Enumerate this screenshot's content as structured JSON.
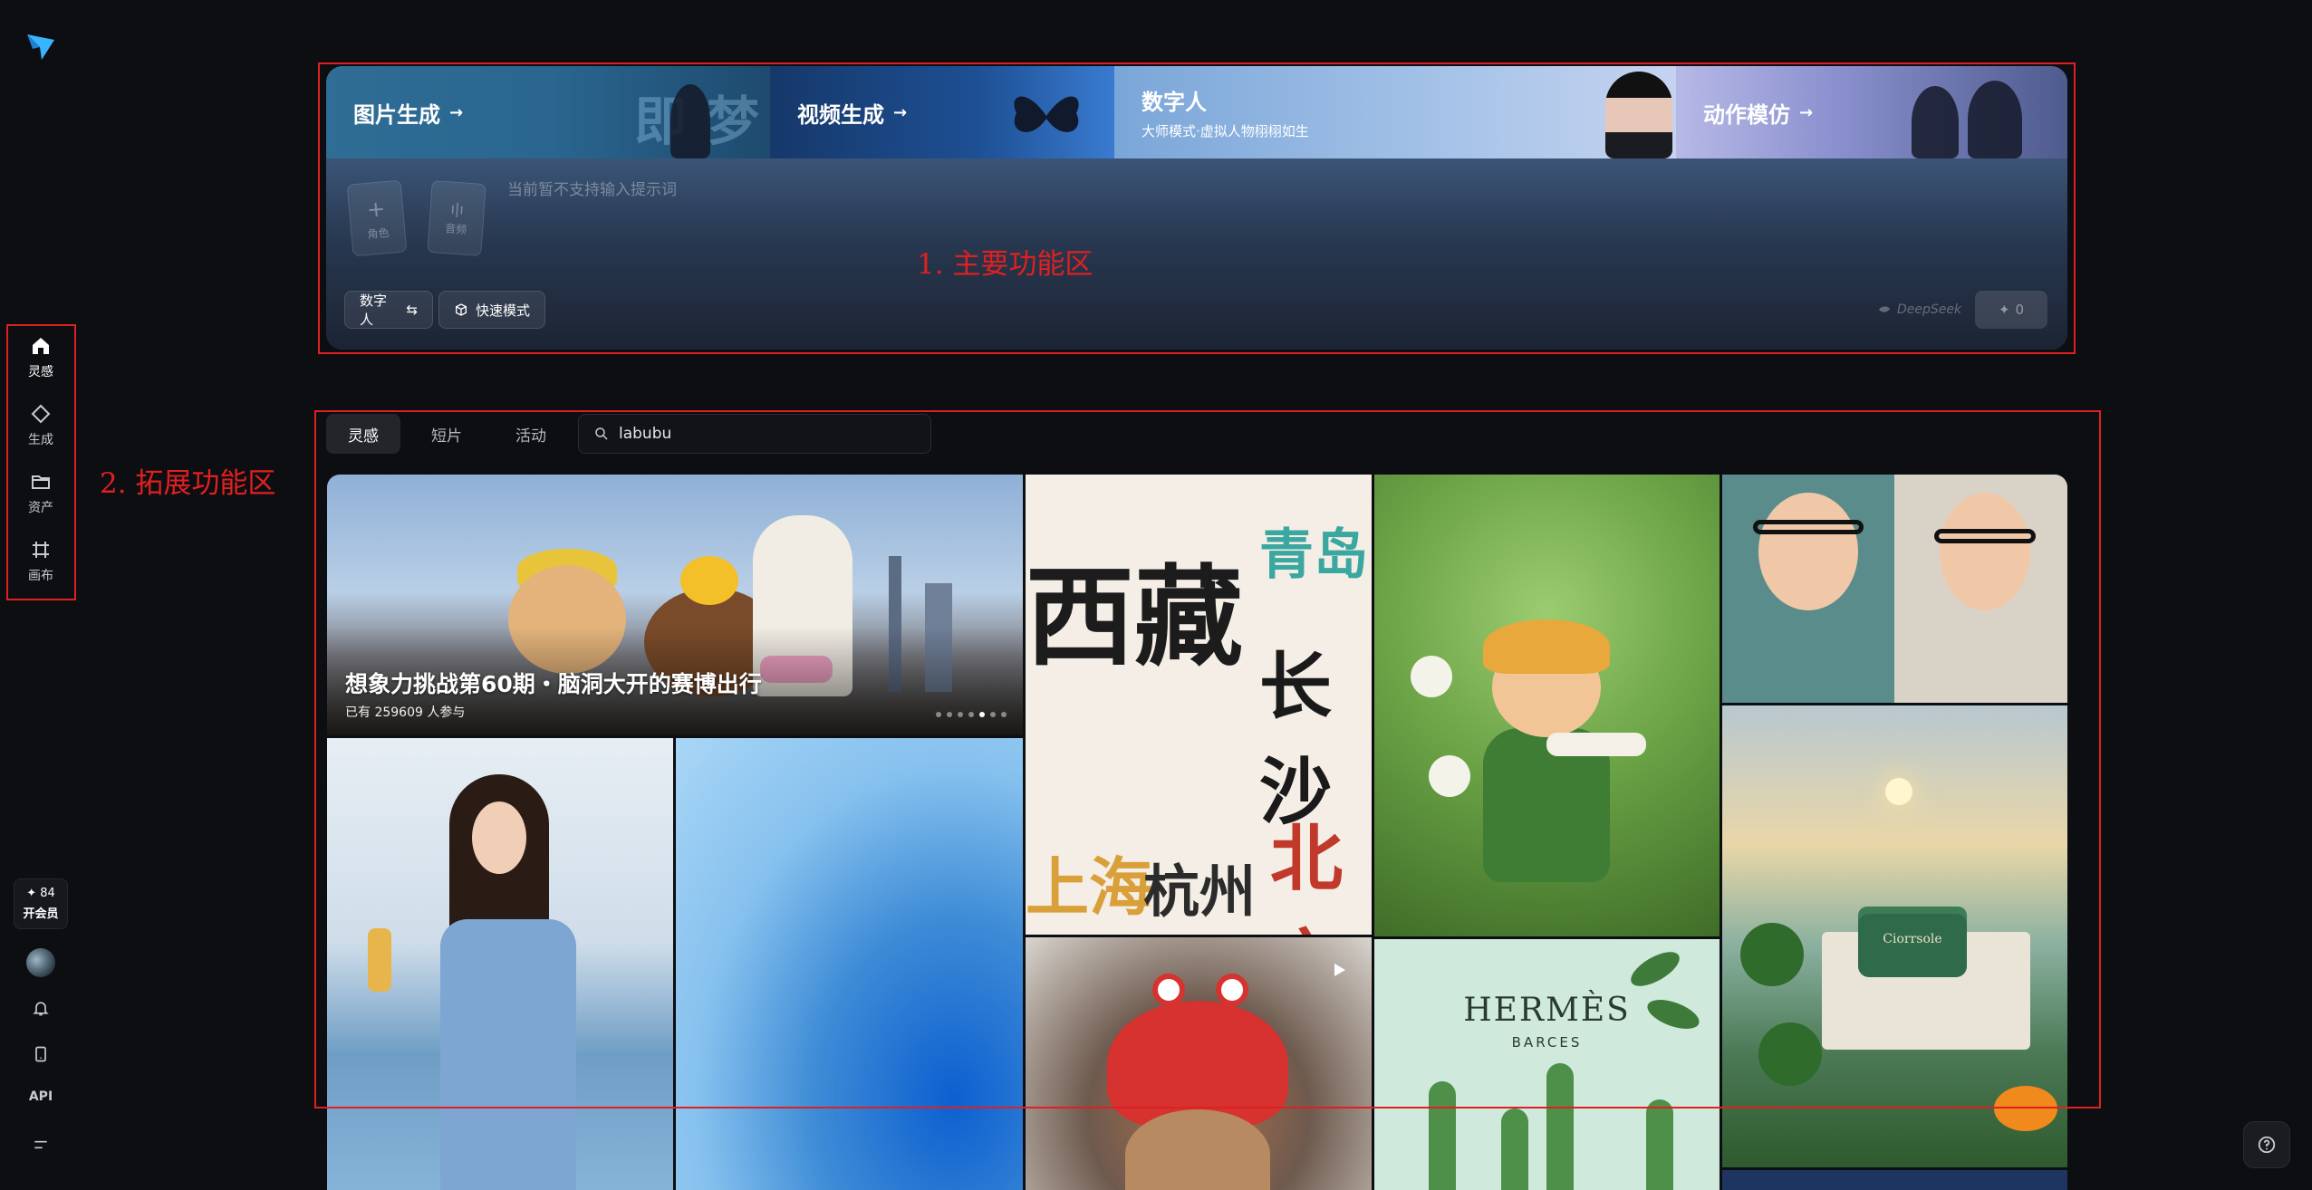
{
  "sidebar": {
    "nav": [
      {
        "label": "灵感",
        "icon": "home-icon"
      },
      {
        "label": "生成",
        "icon": "diamond-icon"
      },
      {
        "label": "资产",
        "icon": "folder-icon"
      },
      {
        "label": "画布",
        "icon": "canvas-icon"
      }
    ],
    "credits": {
      "amount": "✦ 84",
      "vip_label": "开会员"
    },
    "api_label": "API"
  },
  "banner": {
    "image_gen": {
      "label": "图片生成",
      "arrow": "→"
    },
    "video_gen": {
      "label": "视频生成",
      "arrow": "→"
    },
    "digital_human": {
      "label": "数字人",
      "subtitle": "大师模式·虚拟人物栩栩如生"
    },
    "motion_mimic": {
      "label": "动作模仿",
      "arrow": "→"
    },
    "decor_text_1": "即",
    "decor_text_2": "梦"
  },
  "prompt": {
    "role_card": {
      "symbol": "+",
      "label": "角色"
    },
    "voice_card": {
      "symbol": "ı|ı",
      "label": "音频"
    },
    "placeholder": "当前暂不支持输入提示词",
    "mode_pill": "数字人",
    "mode_pill_icon": "⇆",
    "fast_pill": "快速模式",
    "deepseek_label": "DeepSeek",
    "generate_cost": "0"
  },
  "annotations": {
    "main_area": "1. 主要功能区",
    "extension_area": "2. 拓展功能区"
  },
  "tabs": [
    {
      "label": "灵感",
      "active": true
    },
    {
      "label": "短片",
      "active": false
    },
    {
      "label": "活动",
      "active": false
    }
  ],
  "search": {
    "value": "labubu"
  },
  "gallery": {
    "feature": {
      "title": "想象力挑战第60期・脑洞大开的赛博出行",
      "subtitle": "已有 259609 人参与"
    },
    "cities": {
      "xizang": "西藏",
      "qingdao": "青岛",
      "changsha": "长沙",
      "shanghai": "上海",
      "hangzhou": "杭州",
      "beijing": "北京"
    },
    "hermes": {
      "title": "HERMÈS",
      "subtitle": "BARCES"
    },
    "cream": {
      "label": "Ciorrsole"
    }
  },
  "colors": {
    "background": "#0d0e12",
    "annotation": "#e02020",
    "active_tab": "#23252b"
  }
}
